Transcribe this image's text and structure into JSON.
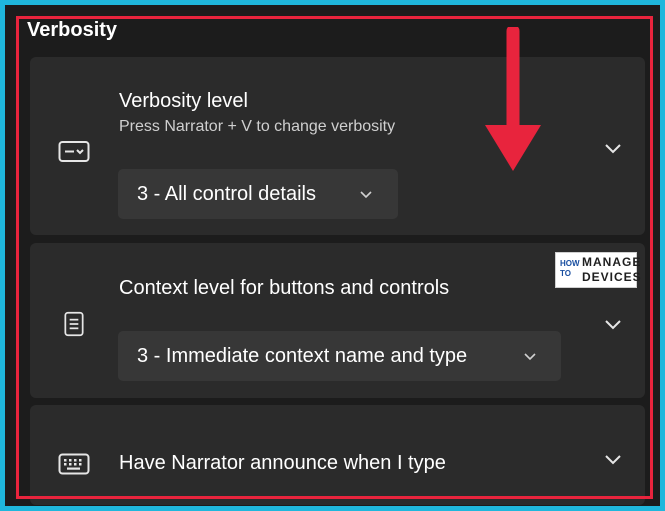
{
  "section": {
    "title": "Verbosity"
  },
  "verbosity_level": {
    "title": "Verbosity level",
    "subtitle": "Press Narrator + V to change verbosity",
    "selected": "3 - All control details",
    "icon": "verbosity-icon"
  },
  "context_level": {
    "title": "Context level for buttons and controls",
    "selected": "3 - Immediate context name and type",
    "icon": "document-icon"
  },
  "typing": {
    "title": "Have Narrator announce when I type",
    "icon": "keyboard-icon"
  },
  "logo": {
    "how": "HOW",
    "to": "TO",
    "manage": "MANAGE",
    "devices": "DEVICES"
  },
  "colors": {
    "background": "#1c1c1c",
    "card": "#2b2b2b",
    "dropdown": "#373737",
    "annotation_red": "#e8243d",
    "outer_border": "#1fb7dc"
  }
}
